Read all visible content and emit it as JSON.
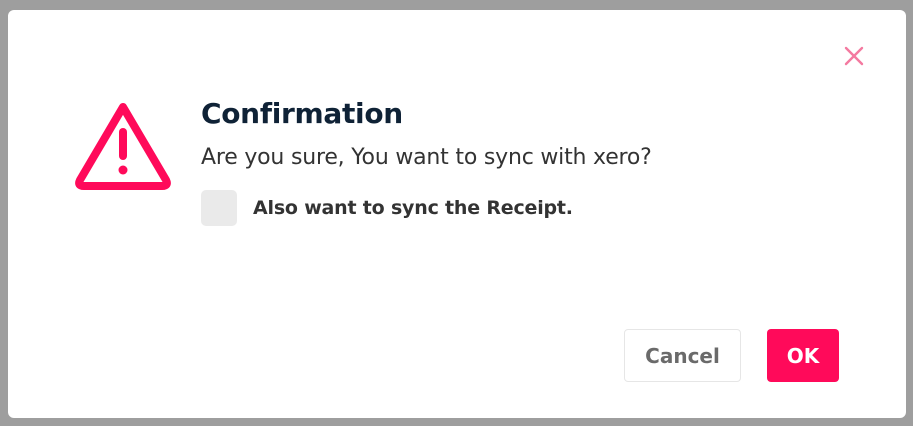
{
  "dialog": {
    "title": "Confirmation",
    "message": "Are you sure, You want to sync with xero?",
    "checkbox": {
      "label": "Also want to sync the Receipt.",
      "checked": false
    },
    "buttons": {
      "cancel_label": "Cancel",
      "ok_label": "OK"
    },
    "icons": {
      "warning": "warning-triangle-icon",
      "close": "close-icon"
    }
  },
  "colors": {
    "accent": "#ff0a5a",
    "close_icon": "#f47aa0",
    "title": "#0f2236",
    "text": "#333333",
    "checkbox_bg": "#eaeaea",
    "backdrop": "#9e9e9e"
  }
}
